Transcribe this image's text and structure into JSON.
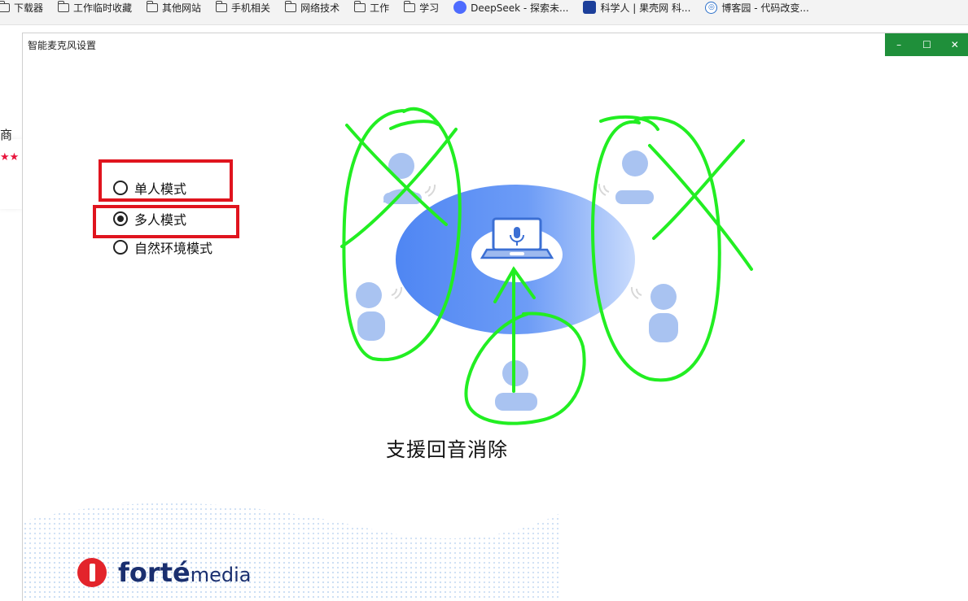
{
  "bookmarks": [
    {
      "label": "下载器",
      "icon": "folder-icon"
    },
    {
      "label": "工作临时收藏",
      "icon": "folder-icon"
    },
    {
      "label": "其他网站",
      "icon": "folder-icon"
    },
    {
      "label": "手机相关",
      "icon": "folder-icon"
    },
    {
      "label": "网络技术",
      "icon": "folder-icon"
    },
    {
      "label": "工作",
      "icon": "folder-icon"
    },
    {
      "label": "学习",
      "icon": "folder-icon"
    },
    {
      "label": "DeepSeek - 探索未...",
      "icon": "deepseek-icon"
    },
    {
      "label": "科学人 | 果壳网 科...",
      "icon": "guokr-icon"
    },
    {
      "label": "博客园 - 代码改变...",
      "icon": "cnblogs-icon"
    }
  ],
  "background_page": {
    "partial_text": "商",
    "stars": "★★"
  },
  "dialog": {
    "title": "智能麦克风设置",
    "controls": {
      "minimize": "–",
      "maximize": "☐",
      "close": "✕"
    },
    "accent": "#1f8f3a"
  },
  "modes": [
    {
      "label": "单人模式",
      "selected": false
    },
    {
      "label": "多人模式",
      "selected": true
    },
    {
      "label": "自然环境模式",
      "selected": false
    }
  ],
  "caption": "支援回音消除",
  "logo": {
    "forte": "forté",
    "media": "media"
  },
  "colors": {
    "annotation_green": "#22ee22",
    "annotation_red": "#e0141e",
    "ellipse": "#5b8ff5"
  }
}
